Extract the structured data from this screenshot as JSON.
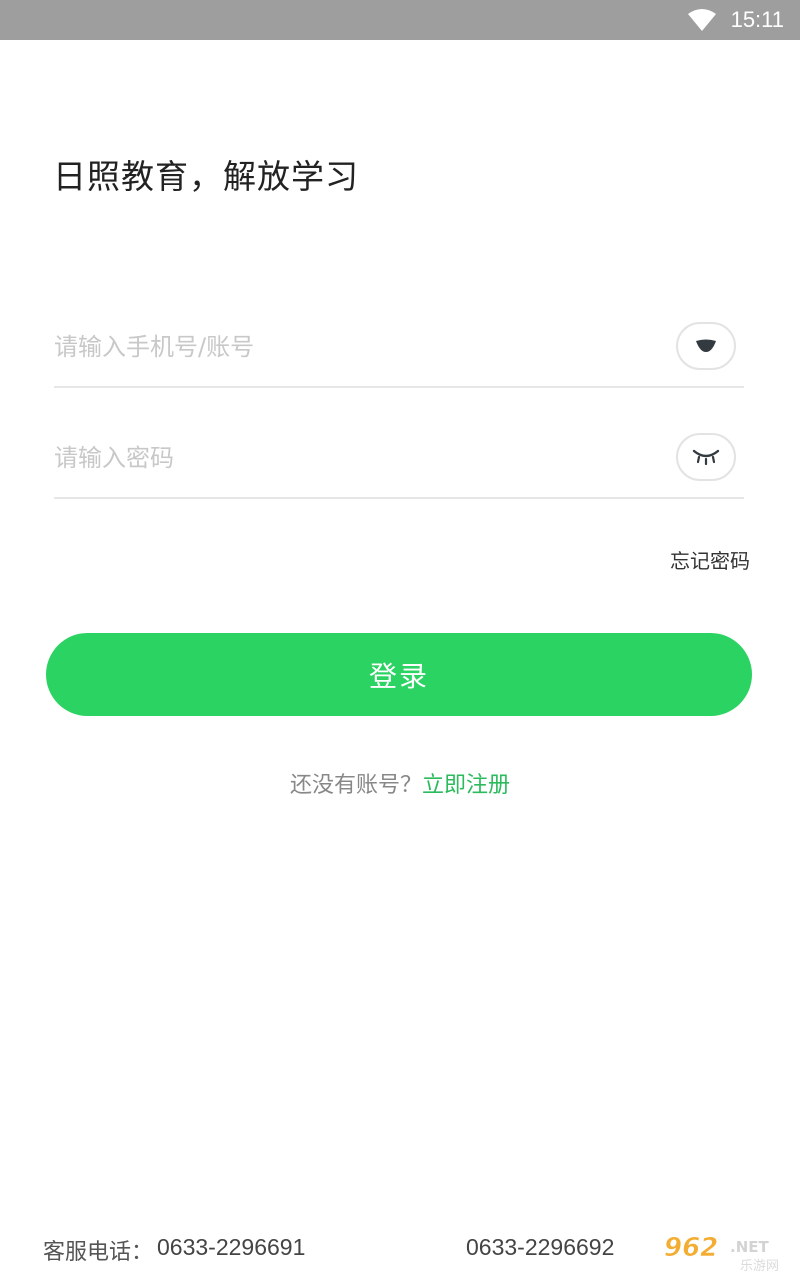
{
  "status_bar": {
    "time": "15:11",
    "icons": [
      "wifi-icon"
    ]
  },
  "slogan": "日照教育，解放学习",
  "login_form": {
    "account_placeholder": "请输入手机号/账号",
    "account_value": "",
    "account_toggle_icon": "dropdown-arrow-icon",
    "password_placeholder": "请输入密码",
    "password_value": "",
    "password_toggle_icon": "closed-eye-icon",
    "forgot_password": "忘记密码",
    "login_button": "登录"
  },
  "register": {
    "prompt": "还没有账号？",
    "link": "立即注册"
  },
  "footer": {
    "label": "客服电话：",
    "phone_1": "0633-2296691",
    "phone_2": "0633-2296692"
  },
  "watermark": {
    "logo": "962.NET",
    "subtitle": "乐游网"
  },
  "colors": {
    "accent": "#2bd363",
    "link": "#2bbb5c",
    "status_bar": "#9e9e9e"
  }
}
